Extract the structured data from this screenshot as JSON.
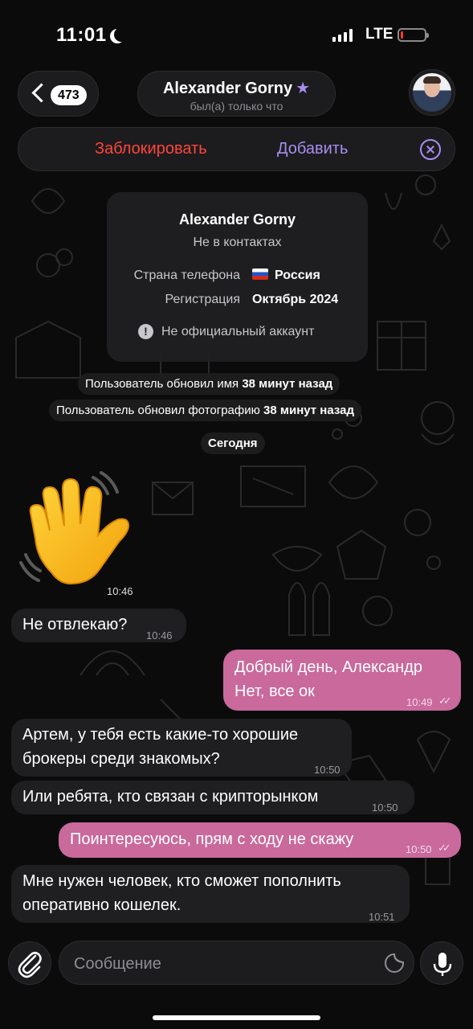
{
  "status_bar": {
    "time": "11:01",
    "network": "LTE",
    "battery_level": 0.1
  },
  "header": {
    "unread_count": "473",
    "contact_name": "Alexander Gorny",
    "last_seen": "был(а) только что"
  },
  "actions": {
    "block": "Заблокировать",
    "add": "Добавить"
  },
  "info_card": {
    "name": "Alexander Gorny",
    "subtitle": "Не в контактах",
    "phone_country_label": "Страна телефона",
    "phone_country_value": "Россия",
    "registration_label": "Регистрация",
    "registration_value": "Октябрь 2024",
    "warning": "Не официальный аккаунт"
  },
  "service": {
    "name_update_text": "Пользователь обновил имя",
    "name_update_time": "38 минут назад",
    "photo_update_text": "Пользователь обновил фотографию",
    "photo_update_time": "38 минут назад",
    "date_divider": "Сегодня"
  },
  "messages": [
    {
      "direction": "in",
      "type": "sticker",
      "sticker": "waving-hand",
      "time": "10:46"
    },
    {
      "direction": "in",
      "lines": [
        "Не отвлекаю?"
      ],
      "time": "10:46"
    },
    {
      "direction": "out",
      "lines": [
        "Добрый день, Александр",
        "Нет, все ок"
      ],
      "time": "10:49",
      "read": true
    },
    {
      "direction": "in",
      "lines": [
        "Артем, у тебя есть какие-то хорошие",
        "брокеры среди знакомых?"
      ],
      "time": "10:50"
    },
    {
      "direction": "in",
      "lines": [
        "Или ребята, кто связан с крипторынком"
      ],
      "time": "10:50"
    },
    {
      "direction": "out",
      "lines": [
        "Поинтересуюсь, прям с ходу не скажу"
      ],
      "time": "10:50",
      "read": true
    },
    {
      "direction": "in",
      "lines": [
        "Мне нужен человек, кто сможет пополнить",
        "оперативно кошелек."
      ],
      "time": "10:51"
    }
  ],
  "composer": {
    "placeholder": "Сообщение"
  },
  "colors": {
    "accent": "#a88df0",
    "danger": "#ff453a",
    "outgoing": "#c9699c",
    "incoming": "#1f1f21"
  }
}
